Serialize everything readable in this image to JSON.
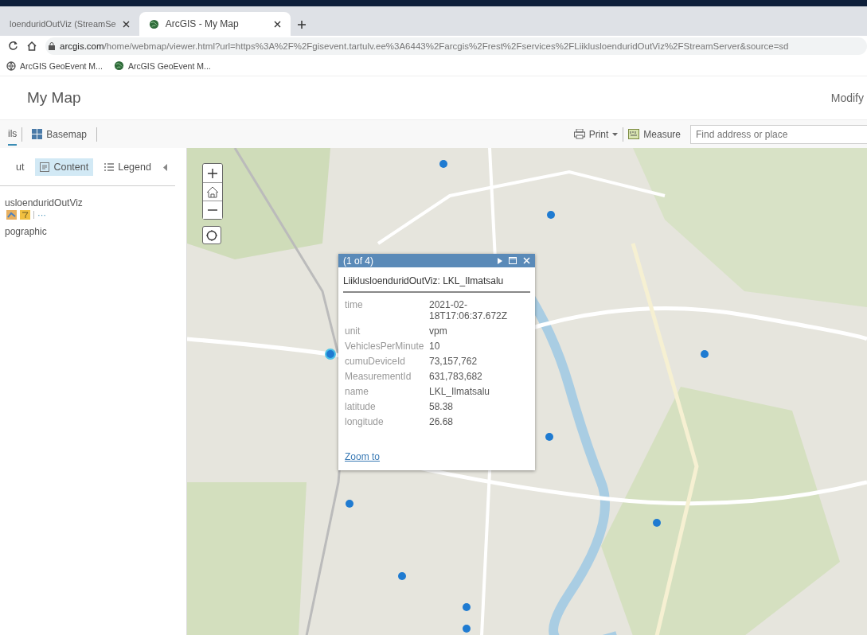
{
  "browser": {
    "tabs": [
      {
        "title": "loenduridOutViz (StreamSe",
        "selected": false
      },
      {
        "title": "ArcGIS - My Map",
        "selected": true
      }
    ],
    "url_host": "arcgis.com",
    "url_path": "/home/webmap/viewer.html?url=https%3A%2F%2Fgisevent.tartulv.ee%3A6443%2Farcgis%2Frest%2Fservices%2FLiiklusloenduridOutViz%2FStreamServer&source=sd",
    "bookmarks": [
      "ArcGIS GeoEvent M...",
      "ArcGIS GeoEvent M..."
    ]
  },
  "header": {
    "title": "My Map",
    "action": "Modify"
  },
  "toolbar": {
    "left": [
      "ils",
      "Basemap"
    ],
    "print": "Print",
    "measure": "Measure",
    "search": {
      "placeholder": "Find address or place"
    }
  },
  "panel": {
    "tabs": [
      {
        "label": "ut",
        "selected": false
      },
      {
        "label": "Content",
        "selected": true
      },
      {
        "label": "Legend",
        "selected": false
      }
    ],
    "layers": [
      {
        "name": "usloenduridOutViz",
        "more": "···"
      },
      {
        "name": "pographic"
      }
    ]
  },
  "popup": {
    "counter": "(1 of 4)",
    "title": "LiiklusloenduridOutViz: LKL_Ilmatsalu",
    "fields": [
      {
        "label": "time",
        "value": "2021-02-18T17:06:37.672Z"
      },
      {
        "label": "unit",
        "value": "vpm"
      },
      {
        "label": "VehiclesPerMinute",
        "value": "10"
      },
      {
        "label": "cumuDeviceId",
        "value": "73,157,762"
      },
      {
        "label": "MeasurementId",
        "value": "631,783,682"
      },
      {
        "label": "name",
        "value": "LKL_Ilmatsalu"
      },
      {
        "label": "latitude",
        "value": "58.38"
      },
      {
        "label": "longitude",
        "value": "26.68"
      }
    ],
    "link": "Zoom to"
  }
}
